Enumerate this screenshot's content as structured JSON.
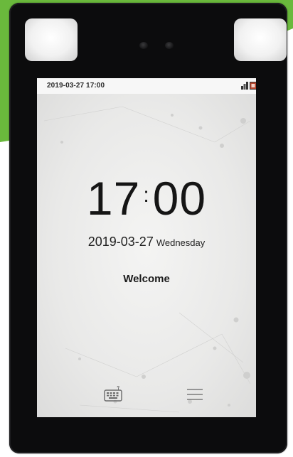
{
  "status_bar": {
    "datetime": "2019-03-27 17:00",
    "icons": [
      "network-icon",
      "device-status-icon"
    ]
  },
  "clock": {
    "hours": "17",
    "separator": ":",
    "minutes": "00"
  },
  "date": {
    "value": "2019-03-27",
    "weekday": "Wednesday"
  },
  "welcome_text": "Welcome",
  "bottom_bar": {
    "left_icon": "keyboard-icon",
    "right_icon": "menu-icon"
  },
  "colors": {
    "accent_green": "#6ab93c",
    "device_body": "#0c0c0d",
    "screen_bg": "#ececeb"
  }
}
